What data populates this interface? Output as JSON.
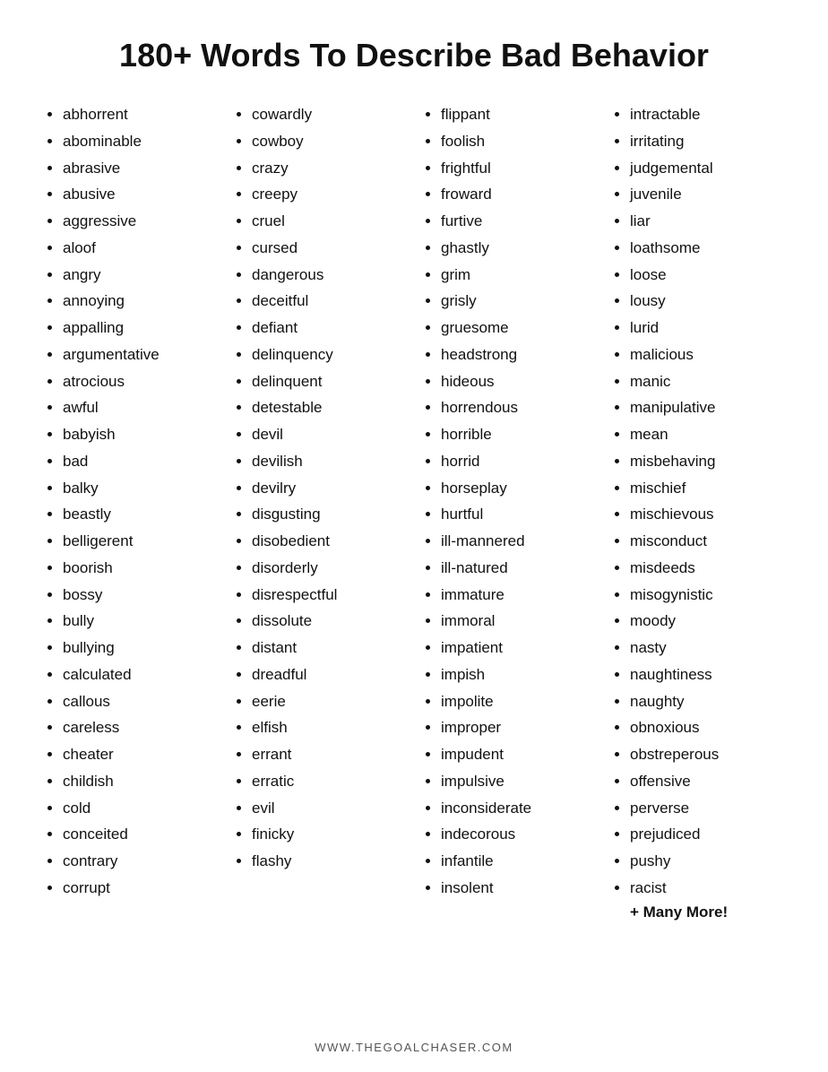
{
  "title": "180+ Words To Describe Bad Behavior",
  "columns": [
    {
      "id": "col1",
      "words": [
        "abhorrent",
        "abominable",
        "abrasive",
        "abusive",
        "aggressive",
        "aloof",
        "angry",
        "annoying",
        "appalling",
        "argumentative",
        "atrocious",
        "awful",
        "babyish",
        "bad",
        "balky",
        "beastly",
        "belligerent",
        "boorish",
        "bossy",
        "bully",
        "bullying",
        "calculated",
        "callous",
        "careless",
        "cheater",
        "childish",
        "cold",
        "conceited",
        "contrary",
        "corrupt"
      ]
    },
    {
      "id": "col2",
      "words": [
        "cowardly",
        "cowboy",
        "crazy",
        "creepy",
        "cruel",
        "cursed",
        "dangerous",
        "deceitful",
        "defiant",
        "delinquency",
        "delinquent",
        "detestable",
        "devil",
        "devilish",
        "devilry",
        "disgusting",
        "disobedient",
        "disorderly",
        "disrespectful",
        "dissolute",
        "distant",
        "dreadful",
        "eerie",
        "elfish",
        "errant",
        "erratic",
        "evil",
        "finicky",
        "flashy"
      ]
    },
    {
      "id": "col3",
      "words": [
        "flippant",
        "foolish",
        "frightful",
        "froward",
        "furtive",
        "ghastly",
        "grim",
        "grisly",
        "gruesome",
        "headstrong",
        "hideous",
        "horrendous",
        "horrible",
        "horrid",
        "horseplay",
        "hurtful",
        "ill-mannered",
        "ill-natured",
        "immature",
        "immoral",
        "impatient",
        "impish",
        "impolite",
        "improper",
        "impudent",
        "impulsive",
        "inconsiderate",
        "indecorous",
        "infantile",
        "insolent"
      ]
    },
    {
      "id": "col4",
      "words": [
        "intractable",
        "irritating",
        "judgemental",
        "juvenile",
        "liar",
        "loathsome",
        "loose",
        "lousy",
        "lurid",
        "malicious",
        "manic",
        "manipulative",
        "mean",
        "misbehaving",
        "mischief",
        "mischievous",
        "misconduct",
        "misdeeds",
        "misogynistic",
        "moody",
        "nasty",
        "naughtiness",
        "naughty",
        "obnoxious",
        "obstreperous",
        "offensive",
        "perverse",
        "prejudiced",
        "pushy",
        "racist"
      ],
      "suffix": "+ Many More!"
    }
  ],
  "footer": "WWW.THEGOALCHASER.COM"
}
